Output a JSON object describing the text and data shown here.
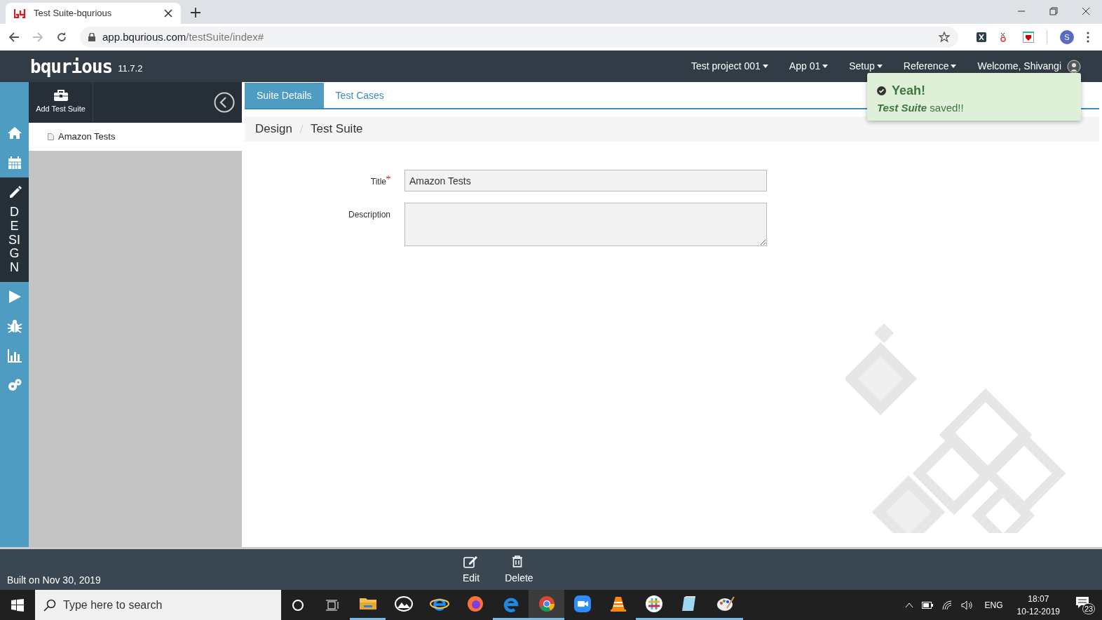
{
  "browser": {
    "tab_title": "Test Suite-bqurious",
    "url_host": "app.bqurious.com",
    "url_path": "/testSuite/index#",
    "profile_initial": "S"
  },
  "header": {
    "logo": "bqurious",
    "version": "11.7.2",
    "menus": [
      "Test project 001",
      "App 01",
      "Setup",
      "Reference"
    ],
    "welcome": "Welcome, Shivangi"
  },
  "toast": {
    "title": "Yeah!",
    "message": "**Test Suite** saved!!"
  },
  "nav": [
    {
      "kind": "home",
      "selected": false
    },
    {
      "kind": "calendar",
      "selected": false
    },
    {
      "kind": "design",
      "label": "DESIGN",
      "selected": true
    },
    {
      "kind": "run",
      "selected": false
    },
    {
      "kind": "bug",
      "selected": false
    },
    {
      "kind": "chart",
      "selected": false
    },
    {
      "kind": "settings",
      "selected": false
    }
  ],
  "tree_panel": {
    "add_button": "Add Test Suite",
    "items": [
      {
        "label": "Amazon Tests"
      }
    ]
  },
  "tabs": [
    {
      "label": "Suite Details",
      "selected": true
    },
    {
      "label": "Test Cases",
      "selected": false
    }
  ],
  "breadcrumb": [
    "Design",
    "Test Suite"
  ],
  "form": {
    "fields": [
      {
        "label": "Title",
        "required": true,
        "kind": "text",
        "value": "Amazon Tests"
      },
      {
        "label": "Description",
        "required": false,
        "kind": "textarea"
      }
    ]
  },
  "footer": {
    "built": "Built on Nov 30, 2019",
    "actions": [
      {
        "kind": "edit",
        "label": "Edit"
      },
      {
        "kind": "delete",
        "label": "Delete"
      }
    ]
  },
  "taskbar": {
    "search_placeholder": "Type here to search",
    "apps": [
      {
        "kind": "folder",
        "running": true,
        "selected": false
      },
      {
        "kind": "photos",
        "running": false,
        "selected": false
      },
      {
        "kind": "ie",
        "running": false,
        "selected": false
      },
      {
        "kind": "firefox",
        "running": false,
        "selected": false
      },
      {
        "kind": "edge",
        "running": true,
        "selected": false
      },
      {
        "kind": "chrome",
        "running": true,
        "selected": true
      },
      {
        "kind": "zoom",
        "running": false,
        "selected": false
      },
      {
        "kind": "vlc",
        "running": false,
        "selected": false
      },
      {
        "kind": "slack",
        "running": true,
        "selected": false
      },
      {
        "kind": "notepad",
        "running": true,
        "selected": false
      },
      {
        "kind": "paint",
        "running": true,
        "selected": false
      }
    ],
    "language": "ENG",
    "time": "18:07",
    "date": "10-12-2019",
    "notifications": "23"
  }
}
